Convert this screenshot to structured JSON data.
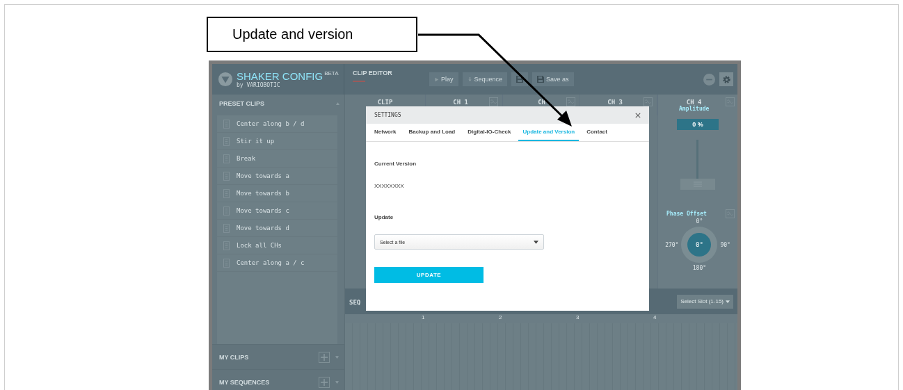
{
  "callout": {
    "label": "Update and version"
  },
  "app": {
    "logo": {
      "title": "SHAKER CONFIG",
      "badge": "BETA",
      "subtitle": "by VARIOBOTIC"
    },
    "editor_title": "CLIP EDITOR",
    "toolbar": [
      {
        "kind": "play",
        "label": "Play"
      },
      {
        "kind": "download",
        "label": "Sequence"
      },
      {
        "kind": "save"
      },
      {
        "kind": "save",
        "label": "Save as"
      }
    ],
    "sidebar": {
      "title": "PRESET CLIPS",
      "expanded": true,
      "presets": [
        {
          "label": "Center along b / d"
        },
        {
          "label": "Stir it up"
        },
        {
          "label": "Break"
        },
        {
          "label": "Move towards a"
        },
        {
          "label": "Move towards b"
        },
        {
          "label": "Move towards c"
        },
        {
          "label": "Move towards d"
        },
        {
          "label": "Lock all CHs"
        },
        {
          "label": "Center along a / c"
        }
      ],
      "sections": [
        {
          "label": "MY CLIPS"
        },
        {
          "label": "MY SEQUENCES"
        }
      ]
    },
    "columns": [
      {
        "kind": "clip",
        "label": "CLIP"
      },
      {
        "kind": "channel",
        "label": "CH 1"
      },
      {
        "kind": "channel",
        "label": "CH"
      },
      {
        "kind": "channel",
        "label": "CH 3"
      }
    ],
    "ch4": {
      "label": "CH 4",
      "parameter": "Amplitude",
      "reading": "0 %",
      "level": 0,
      "phase": {
        "label": "Phase Offset",
        "value": "0°",
        "top": "0°",
        "right": "90°",
        "bottom": "180°",
        "left": "270°"
      }
    },
    "sequence": {
      "title": "SEQ",
      "slot_select": "Select Slot (1-15)",
      "bars": [
        "1",
        "2",
        "3",
        "4"
      ]
    }
  },
  "modal": {
    "title": "SETTINGS",
    "tabs": [
      {
        "label": "Network",
        "selected": false
      },
      {
        "label": "Backup and Load",
        "selected": false
      },
      {
        "label": "Digital-IO-Check",
        "selected": false
      },
      {
        "label": "Update and Version",
        "selected": true
      },
      {
        "label": "Contact",
        "selected": false
      }
    ],
    "version_label": "Current Version",
    "version": "XXXXXXXX",
    "update_label": "Update",
    "file_select": {
      "placeholder": "Select a file"
    },
    "button": "UPDATE"
  }
}
